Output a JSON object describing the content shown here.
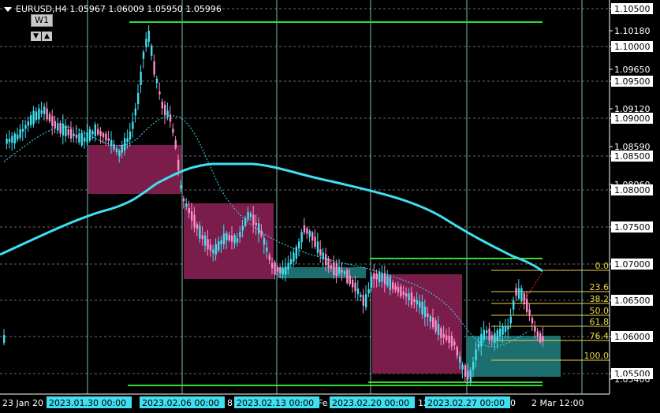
{
  "header": {
    "symbol_line": "EURUSD,H4  1.05967 1.06009 1.05950 1.05996",
    "period_button": "W1",
    "down_arrow": "▼",
    "up_arrow": "▲"
  },
  "price_axis": {
    "ticks": [
      {
        "label": "1.10500",
        "boxed": true
      },
      {
        "label": "1.10180",
        "boxed": false
      },
      {
        "label": "1.10000",
        "boxed": true
      },
      {
        "label": "1.09650",
        "boxed": false
      },
      {
        "label": "1.09500",
        "boxed": true
      },
      {
        "label": "1.09120",
        "boxed": false
      },
      {
        "label": "1.09000",
        "boxed": true
      },
      {
        "label": "1.08590",
        "boxed": false
      },
      {
        "label": "1.08500",
        "boxed": true
      },
      {
        "label": "1.08060",
        "boxed": false
      },
      {
        "label": "1.08000",
        "boxed": true
      },
      {
        "label": "1.07500",
        "boxed": true
      },
      {
        "label": "1.07000",
        "boxed": true
      },
      {
        "label": "1.06500",
        "boxed": true
      },
      {
        "label": "1.06000",
        "boxed": true
      },
      {
        "label": "1.05500",
        "boxed": true
      },
      {
        "label": "1.05400",
        "boxed": false
      }
    ]
  },
  "time_axis": {
    "plain": [
      {
        "label": "23 Jan 20"
      },
      {
        "label": "0"
      },
      {
        "label": "8"
      },
      {
        "label": "Fe"
      },
      {
        "label": "12"
      },
      {
        "label": "0"
      },
      {
        "label": "2 Mar 12:00"
      }
    ],
    "highlighted": [
      {
        "label": "2023.01.30 00:00"
      },
      {
        "label": "2023.02.06 00:00"
      },
      {
        "label": "2023.02.13 00:00"
      },
      {
        "label": "2023.02.20 00:00"
      },
      {
        "label": "2023.02.27 00:00"
      }
    ]
  },
  "fibonacci": {
    "levels": [
      {
        "label": "0.0"
      },
      {
        "label": "23.6"
      },
      {
        "label": "38.2"
      },
      {
        "label": "50.0"
      },
      {
        "label": "61.8"
      },
      {
        "label": "76.4"
      },
      {
        "label": "100.0"
      }
    ]
  },
  "colors": {
    "background": "#000000",
    "bull_candle": "#40e0f0",
    "bear_candle": "#ff8cc8",
    "ma_line": "#40e0f0",
    "support_line": "#33dd33",
    "fib_line": "#e8d44a",
    "zone_supply": "#7a1d4a",
    "zone_demand": "#1d6e6e",
    "grid_vertical": "#9ee8ee",
    "axis_text": "#ffffff"
  }
}
